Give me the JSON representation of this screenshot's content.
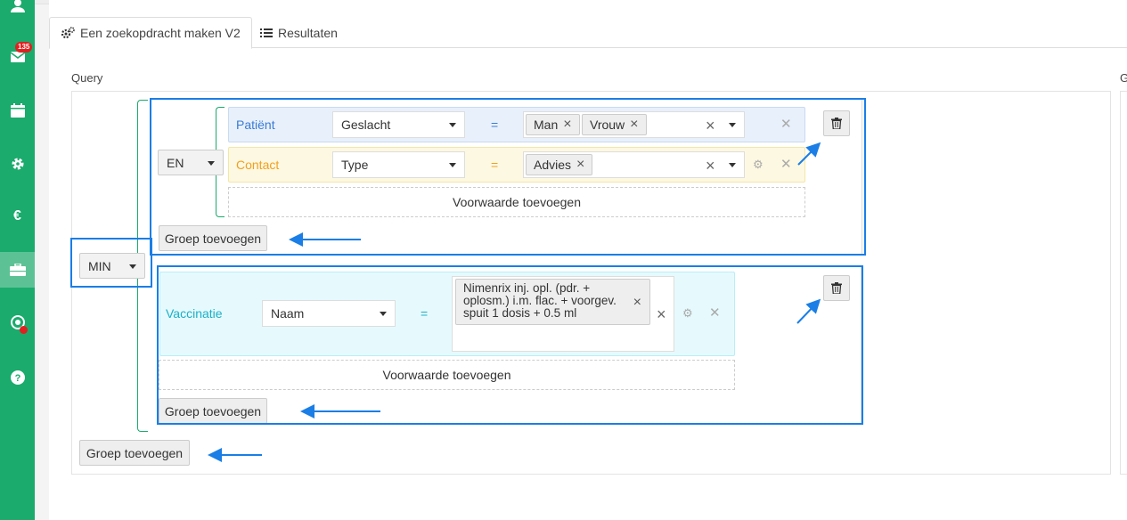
{
  "sidebar": {
    "items": [
      {
        "icon": "users-icon"
      },
      {
        "icon": "mail-icon",
        "badge": "135"
      },
      {
        "icon": "calendar-icon"
      },
      {
        "icon": "gear-icon"
      },
      {
        "icon": "euro-icon"
      },
      {
        "icon": "toolbox-icon",
        "active": true
      },
      {
        "icon": "location-icon"
      },
      {
        "icon": "help-icon"
      }
    ]
  },
  "tabs": [
    {
      "label": "Een zoekopdracht maken V2",
      "icon": "cogs-icon",
      "active": true
    },
    {
      "label": "Resultaten",
      "icon": "list-icon",
      "active": false
    }
  ],
  "query": {
    "title": "Query",
    "right_title": "G",
    "root_operator": "MIN",
    "groups": [
      {
        "operator": "EN",
        "rules": [
          {
            "entity": "Patiënt",
            "field": "Geslacht",
            "operator": "=",
            "values": [
              "Man",
              "Vrouw"
            ]
          },
          {
            "entity": "Contact",
            "field": "Type",
            "operator": "=",
            "values": [
              "Advies"
            ]
          }
        ],
        "add_condition": "Voorwaarde toevoegen",
        "add_group": "Groep toevoegen"
      },
      {
        "rules": [
          {
            "entity": "Vaccinatie",
            "field": "Naam",
            "operator": "=",
            "values": [
              "Nimenrix inj. opl. (pdr. + oplosm.) i.m. flac. + voorgev. spuit 1 dosis + 0.5 ml"
            ]
          }
        ],
        "add_condition": "Voorwaarde toevoegen",
        "add_group": "Groep toevoegen"
      }
    ],
    "add_group": "Groep toevoegen"
  },
  "colors": {
    "sidebar": "#1aab6d",
    "patient_row": "#e8f0fb",
    "contact_row": "#fdf8e1",
    "vaccination_row": "#e6fafd",
    "highlight": "#1a7ee6"
  }
}
